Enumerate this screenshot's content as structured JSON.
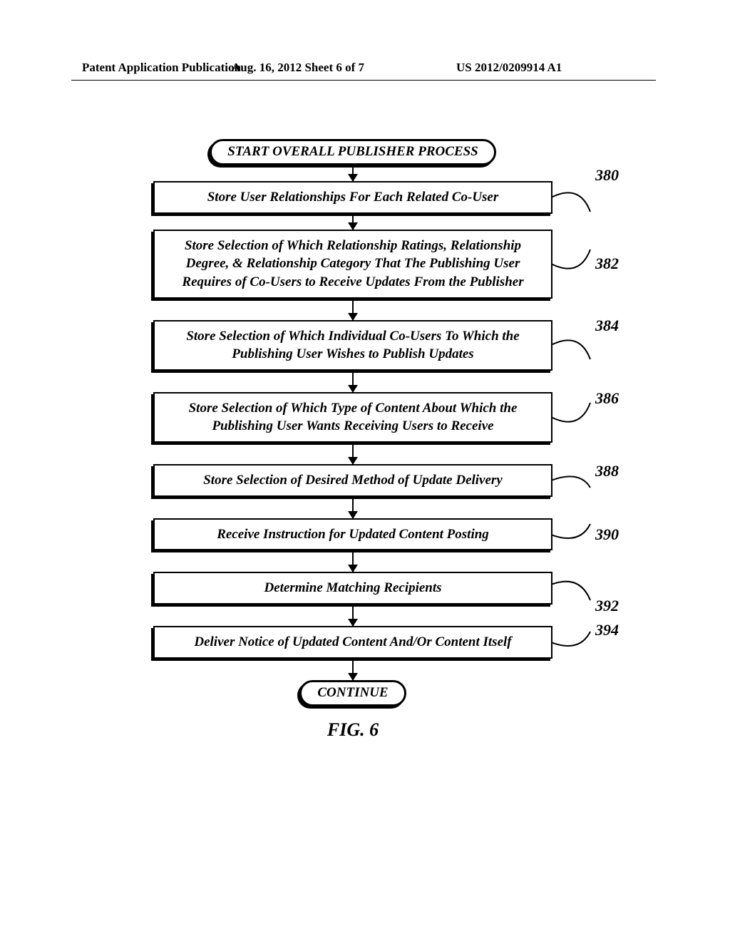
{
  "header": {
    "left": "Patent Application Publication",
    "mid": "Aug. 16, 2012  Sheet 6 of 7",
    "right": "US 2012/0209914 A1"
  },
  "flowchart": {
    "start": "START OVERALL PUBLISHER PROCESS",
    "steps": [
      {
        "text": "Store User Relationships For Each Related Co-User",
        "ref": "380"
      },
      {
        "text": "Store Selection of Which Relationship Ratings, Relationship Degree, & Relationship Category That The Publishing User Requires of Co-Users to Receive Updates From the Publisher",
        "ref": "382"
      },
      {
        "text": "Store Selection of Which Individual Co-Users To Which the Publishing User Wishes to Publish Updates",
        "ref": "384"
      },
      {
        "text": "Store Selection of Which Type of Content About Which the Publishing User Wants Receiving Users to Receive",
        "ref": "386"
      },
      {
        "text": "Store Selection of Desired Method of Update Delivery",
        "ref": "388"
      },
      {
        "text": "Receive Instruction for Updated Content Posting",
        "ref": "390"
      },
      {
        "text": "Determine Matching Recipients",
        "ref": "392"
      },
      {
        "text": "Deliver Notice of Updated Content And/Or Content Itself",
        "ref": "394"
      }
    ],
    "end": "CONTINUE",
    "caption": "FIG. 6"
  }
}
